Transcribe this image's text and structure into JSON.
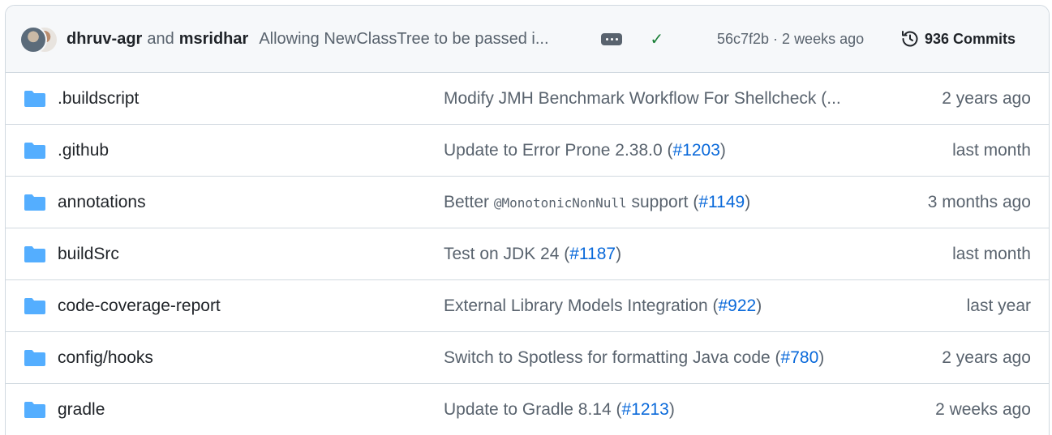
{
  "header": {
    "author1": "dhruv-agr",
    "and_text": "and",
    "author2": "msridhar",
    "message": "Allowing NewClassTree to be passed i...",
    "sha_time": "56c7f2b · 2 weeks ago",
    "commits": "936 Commits",
    "status_color": "#1a7f37"
  },
  "rows": [
    {
      "name": ".buildscript",
      "msg": "Modify JMH Benchmark Workflow For Shellcheck (...",
      "code": "",
      "msg_after": "",
      "link": "",
      "tail": "",
      "age": "2 years ago"
    },
    {
      "name": ".github",
      "msg": "Update to Error Prone 2.38.0 (",
      "code": "",
      "msg_after": "",
      "link": "#1203",
      "tail": ")",
      "age": "last month"
    },
    {
      "name": "annotations",
      "msg": "Better ",
      "code": "@MonotonicNonNull",
      "msg_after": " support (",
      "link": "#1149",
      "tail": ")",
      "age": "3 months ago"
    },
    {
      "name": "buildSrc",
      "msg": "Test on JDK 24 (",
      "code": "",
      "msg_after": "",
      "link": "#1187",
      "tail": ")",
      "age": "last month"
    },
    {
      "name": "code-coverage-report",
      "msg": "External Library Models Integration (",
      "code": "",
      "msg_after": "",
      "link": "#922",
      "tail": ")",
      "age": "last year"
    },
    {
      "name": "config/hooks",
      "msg": "Switch to Spotless for formatting Java code (",
      "code": "",
      "msg_after": "",
      "link": "#780",
      "tail": ")",
      "age": "2 years ago"
    },
    {
      "name": "gradle",
      "msg": "Update to Gradle 8.14 (",
      "code": "",
      "msg_after": "",
      "link": "#1213",
      "tail": ")",
      "age": "2 weeks ago"
    }
  ],
  "colors": {
    "folder": "#54aeff",
    "link": "#0969da",
    "muted": "#59636e"
  },
  "icons": {
    "folder": "folder-icon",
    "history": "history-icon",
    "check": "check-icon",
    "ellipsis": "ellipsis-icon"
  }
}
